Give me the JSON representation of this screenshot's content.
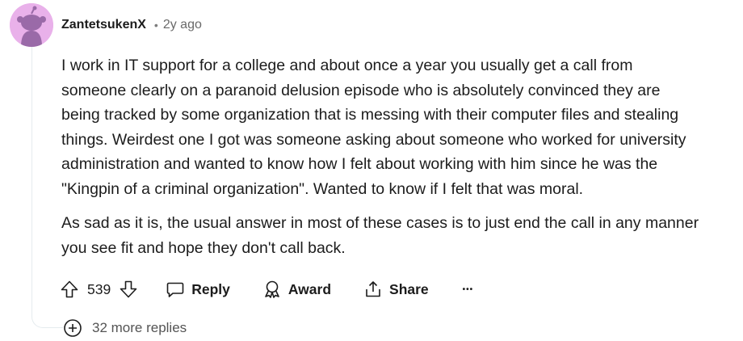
{
  "comment": {
    "username": "ZantetsukenX",
    "separator": "•",
    "time": "2y ago",
    "avatar_color": "#e9b1ea",
    "paragraphs": [
      [
        "I work in IT support for a college and about once a year you usually get a call from",
        "someone clearly on a paranoid delusion episode who is absolutely convinced they are",
        "being tracked by some organization that is messing with their computer files and stealing",
        "things. Weirdest one I got was someone asking about someone who worked for university",
        "administration and wanted to know how I felt about working with him since he was the",
        "\"Kingpin of a criminal organization\". Wanted to know if I felt that was moral."
      ],
      [
        "As sad as it is, the usual answer in most of these cases is to just end the call in any manner",
        "you see fit and hope they don't call back."
      ]
    ]
  },
  "actions": {
    "vote_count": "539",
    "reply_label": "Reply",
    "award_label": "Award",
    "share_label": "Share",
    "more_label": "•••"
  },
  "more_replies": {
    "label": "32 more replies"
  },
  "icons": {
    "upvote": "arrow-up-icon",
    "downvote": "arrow-down-icon",
    "reply": "speech-bubble-icon",
    "award": "award-ribbon-icon",
    "share": "share-icon",
    "more": "ellipsis-icon",
    "expand": "plus-circle-icon"
  }
}
